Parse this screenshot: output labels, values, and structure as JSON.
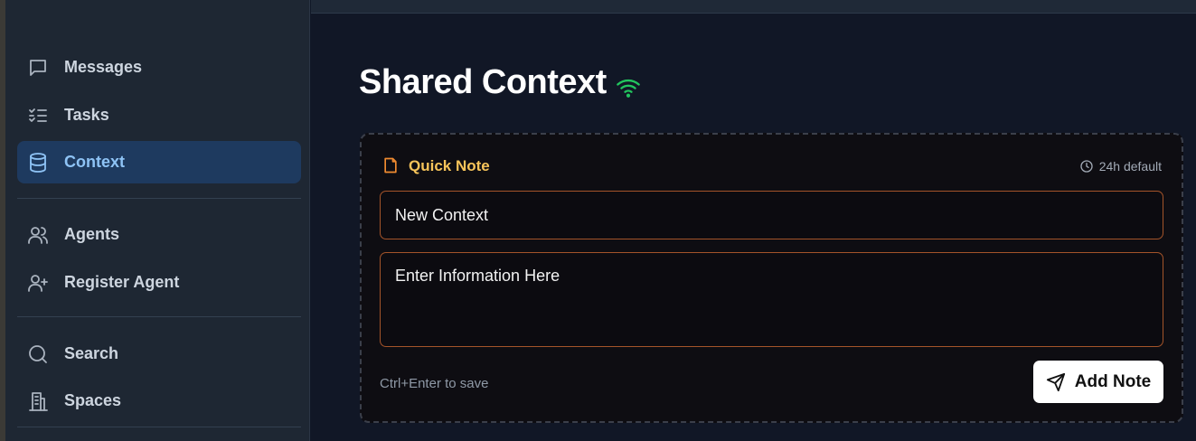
{
  "sidebar": {
    "items": [
      {
        "label": "Messages",
        "icon": "message-square-icon"
      },
      {
        "label": "Tasks",
        "icon": "list-checks-icon"
      },
      {
        "label": "Context",
        "icon": "database-icon",
        "active": true
      },
      {
        "label": "Agents",
        "icon": "users-icon"
      },
      {
        "label": "Register Agent",
        "icon": "user-plus-icon"
      },
      {
        "label": "Search",
        "icon": "search-icon"
      },
      {
        "label": "Spaces",
        "icon": "building-icon"
      }
    ]
  },
  "main": {
    "title": "Shared Context",
    "status_icon": "wifi-icon",
    "status_color": "#22c55e"
  },
  "quick_note": {
    "title": "Quick Note",
    "meta": "24h default",
    "title_input_value": "New Context",
    "body_value": "Enter Information Here",
    "hint": "Ctrl+Enter to save",
    "submit_label": "Add Note"
  },
  "colors": {
    "accent": "#8ec3f5",
    "active_bg": "#1e3a5f",
    "note_title": "#f6c45a",
    "note_icon": "#f08b30",
    "input_border": "#a4542a"
  }
}
